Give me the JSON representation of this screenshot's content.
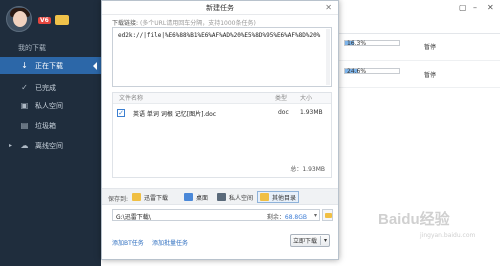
{
  "sidebar": {
    "user_level": "V6",
    "section_title": "我的下载",
    "items": [
      {
        "label": "正在下载",
        "icon": "download-icon"
      },
      {
        "label": "已完成",
        "icon": "check-circle-icon"
      },
      {
        "label": "私人空间",
        "icon": "lock-icon"
      },
      {
        "label": "垃圾箱",
        "icon": "trash-icon"
      },
      {
        "label": "离线空间",
        "icon": "cloud-icon"
      }
    ]
  },
  "main": {
    "rows": [
      {
        "progress": "16.3%",
        "progress_value": 16.3,
        "status": "暂停"
      },
      {
        "progress": "24.6%",
        "progress_value": 24.6,
        "status": "暂停"
      }
    ]
  },
  "dialog": {
    "title": "新建任务",
    "url_label": "下载链接:",
    "url_hint": "(多个URL请用回车分隔，支持1000条任务)",
    "url_value": "ed2k://|file|%E6%88%B1%E6%AF%AD%20%E5%8D%95%E6%AF%8D%20%",
    "table": {
      "headers": {
        "name": "文件名称",
        "type": "类型",
        "size": "大小"
      },
      "rows": [
        {
          "checked": true,
          "name": "英语 单词 词根 记忆[图片].doc",
          "type": "doc",
          "size": "1.93MB"
        }
      ],
      "total": "总：1.93MB"
    },
    "save_label": "保存到:",
    "save_options": [
      "迅雷下载",
      "桌面",
      "私人空间",
      "其他目录"
    ],
    "selected_option": "其他目录",
    "path": "G:\\迅雷下载\\",
    "space_label": "剩余：",
    "space_value": "68.8GB",
    "link_bt": "添加BT任务",
    "link_batch": "添加批量任务",
    "download_button": "立即下载"
  },
  "watermark": {
    "text": "Baidu经验",
    "sub": "jingyan.baidu.com"
  },
  "colors": {
    "sidebar_bg": "#1f2d3d",
    "active_item": "#2c67a8",
    "link": "#2f6fc0",
    "progress": "#7db4ea"
  }
}
